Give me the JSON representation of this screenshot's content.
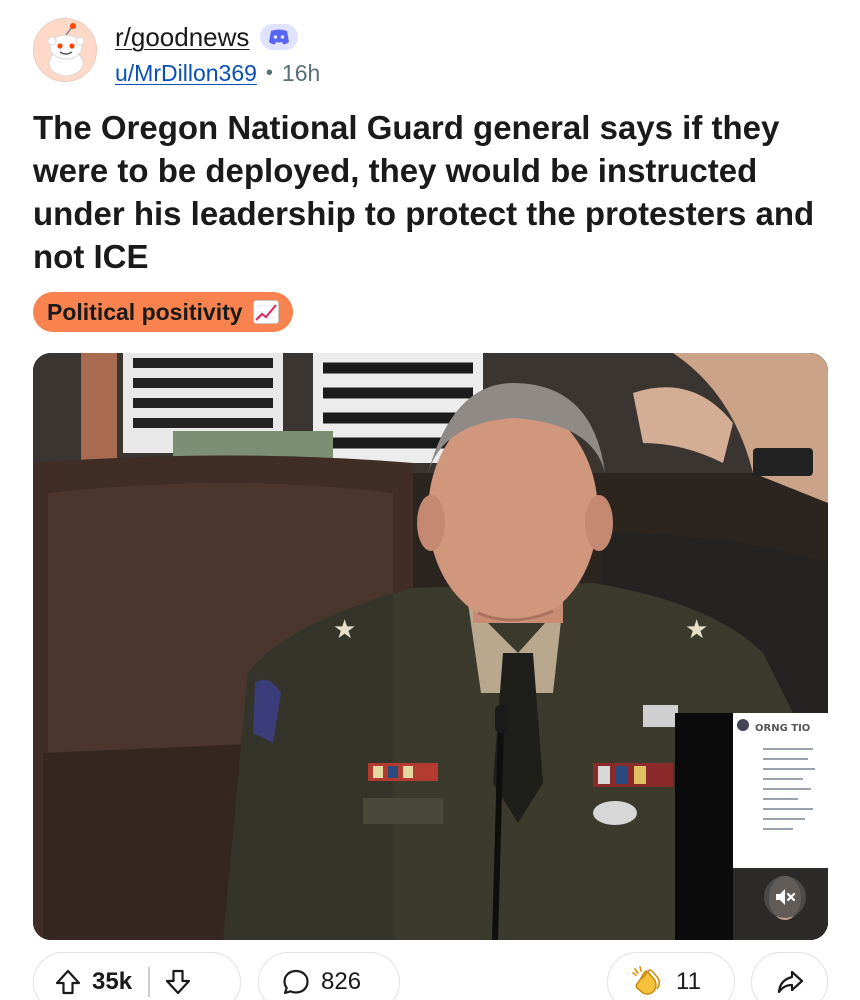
{
  "post": {
    "subreddit": "r/goodnews",
    "author": "u/MrDillon369",
    "separator": "•",
    "age": "16h",
    "title": "The Oregon National Guard general says if they were to be deployed, they would be instructed under his leadership to protect the protesters and not ICE",
    "flair": {
      "label": "Political positivity",
      "icon": "chart-increasing-emoji",
      "color": "#f8834e"
    },
    "media": {
      "type": "video",
      "muted": true,
      "overlay_text": "ORNG TIO"
    }
  },
  "actions": {
    "upvotes": "35k",
    "comments": "826",
    "awards": "11",
    "award_icon": "clapping-hands-emoji",
    "share_icon": "share-arrow-icon"
  },
  "colors": {
    "link_blue": "#0a4fb5",
    "meta_gray": "#576f76",
    "discord": "#5865f2"
  }
}
